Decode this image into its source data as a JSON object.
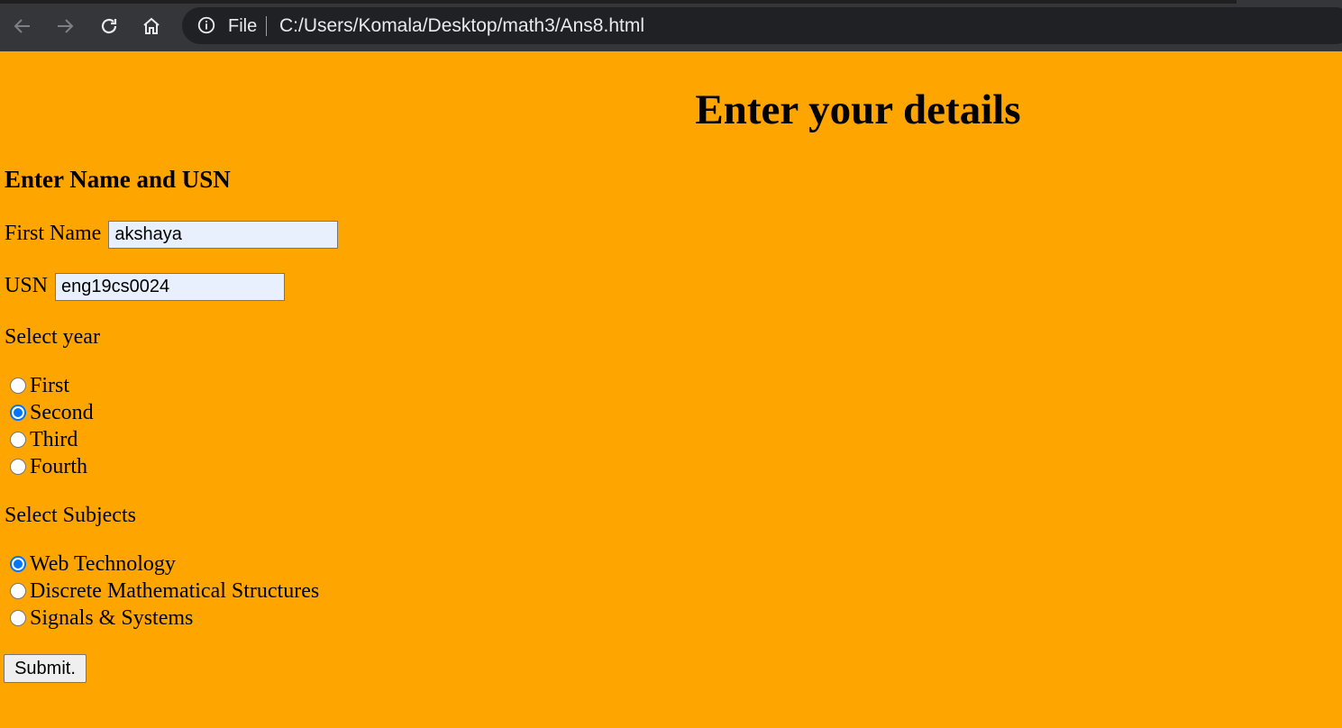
{
  "browser": {
    "scheme_label": "File",
    "url": "C:/Users/Komala/Desktop/math3/Ans8.html",
    "icons": [
      "back-icon",
      "forward-icon",
      "reload-icon",
      "home-icon",
      "info-icon"
    ]
  },
  "page": {
    "background": "#ffa500",
    "title": "Enter your details",
    "section_heading": "Enter Name and USN",
    "first_name": {
      "label": "First Name",
      "value": "akshaya"
    },
    "usn": {
      "label": "USN",
      "value": "eng19cs0024"
    },
    "year": {
      "label": "Select year",
      "options": [
        "First",
        "Second",
        "Third",
        "Fourth"
      ],
      "selected": "Second"
    },
    "subjects": {
      "label": "Select Subjects",
      "options": [
        "Web Technology",
        "Discrete Mathematical Structures",
        "Signals & Systems"
      ],
      "selected": "Web Technology"
    },
    "submit_label": "Submit."
  }
}
